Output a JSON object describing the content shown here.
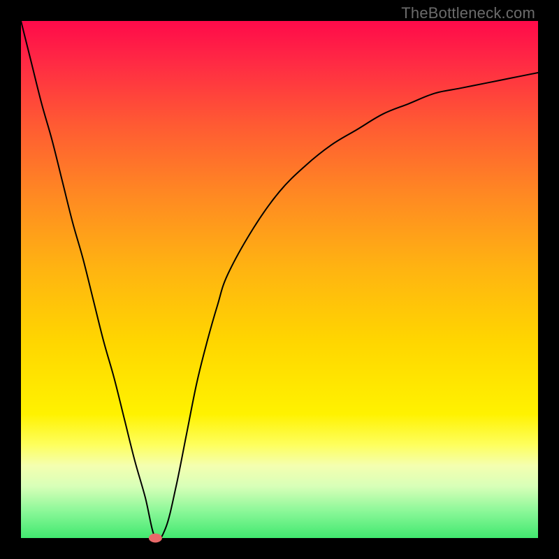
{
  "credit": "TheBottleneck.com",
  "colors": {
    "background": "#000000",
    "top": "#ff0a4a",
    "bottom": "#41e86f",
    "curve": "#000000",
    "marker": "#e86a6a"
  },
  "chart_data": {
    "type": "line",
    "title": "",
    "xlabel": "",
    "ylabel": "",
    "xlim": [
      0,
      100
    ],
    "ylim": [
      0,
      100
    ],
    "x": [
      0,
      2,
      4,
      6,
      8,
      10,
      12,
      14,
      16,
      18,
      20,
      22,
      24,
      26,
      28,
      30,
      32,
      34,
      36,
      38,
      40,
      45,
      50,
      55,
      60,
      65,
      70,
      75,
      80,
      85,
      90,
      95,
      100
    ],
    "values": [
      100,
      92,
      84,
      77,
      69,
      61,
      54,
      46,
      38,
      31,
      23,
      15,
      8,
      0,
      2,
      10,
      20,
      30,
      38,
      45,
      51,
      60,
      67,
      72,
      76,
      79,
      82,
      84,
      86,
      87,
      88,
      89,
      90
    ],
    "marker": {
      "x": 26,
      "y": 0
    },
    "grid": false,
    "legend": false
  }
}
